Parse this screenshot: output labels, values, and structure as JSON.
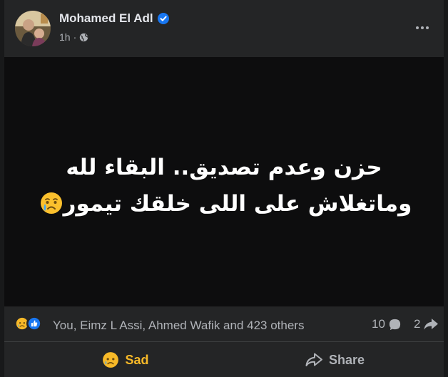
{
  "post": {
    "author": "Mohamed El Adl",
    "time": "1h",
    "text_line1": "حزن وعدم تصديق.. البقاء لله",
    "text_line2": "وماتغلاش على اللى خلقك تيمور"
  },
  "reactions": {
    "names": "You, Eimz L Assi, Ahmed Wafik and 423 others",
    "comments_count": "10",
    "shares_count": "2"
  },
  "actions": {
    "reaction_label": "Sad",
    "share_label": "Share"
  },
  "colors": {
    "verified": "#1877f2",
    "sad": "#f7b928",
    "like": "#1877f2"
  },
  "icons": [
    "verified-icon",
    "globe-icon",
    "more-icon",
    "crying-face-emoji",
    "sad-reaction-icon",
    "like-reaction-icon",
    "comment-icon",
    "share-icon"
  ]
}
